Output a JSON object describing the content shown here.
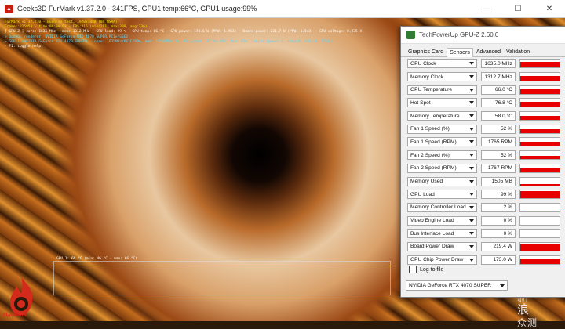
{
  "furmark": {
    "title": "Geeks3D FurMark v1.37.2.0 - 341FPS, GPU1 temp:66°C, GPU1 usage:99%",
    "overlay_lines": [
      {
        "text": "FurMark v1.37.2.0 - Burn-in test, 1920x1080 (0X MSAA)",
        "color": "y"
      },
      {
        "text": "Frames:225858 - time:00:09:03 - FPS:316 (min:281, max:399, avg:336)",
        "color": "y"
      },
      {
        "text": "[ GPU-Z ] core: 1635 MHz - mem: 1312 MHz - GPU load: 99 % - GPU temp: 66 °C - GPU power: 174.6 W (PPW: 1.961) - Board power: 221.7 W (PPW: 1.543) - GPU voltage: 0.935 V",
        "color": "w"
      },
      {
        "text": "> OpenGL renderer: NVIDIA GeForce RTX 4070 SUPER/PCIe/SSE2",
        "color": "c"
      },
      {
        "text": "> GPU 1 (NVIDIA GeForce RTX 4070 SUPER) - core: 1635MHz/66°C/99%, mem: 10500MHz/5%, GPU power: 97.4% TDP, fan: 52%, limits:[power:1, temp:0, volt:0, OV:0]",
        "color": "c"
      },
      {
        "text": "- F1: toggle help",
        "color": "w"
      }
    ],
    "graph_label": "GPU 1: 66 °C (min: 46 °C - max: 66 °C)",
    "logo_text": "FURMARK",
    "watermark_line1": "新",
    "watermark_line2": "浪",
    "watermark_line3": "众测"
  },
  "window_buttons": {
    "minimize": "—",
    "maximize": "☐",
    "close": "✕"
  },
  "gpuz": {
    "title": "TechPowerUp GPU-Z 2.60.0",
    "tabs": [
      {
        "label": "Graphics Card",
        "active": false
      },
      {
        "label": "Sensors",
        "active": true
      },
      {
        "label": "Advanced",
        "active": false
      },
      {
        "label": "Validation",
        "active": false
      }
    ],
    "sensors": [
      {
        "name": "GPU Clock",
        "value": "1635.0 MHz",
        "level": 0.7
      },
      {
        "name": "Memory Clock",
        "value": "1312.7 MHz",
        "level": 0.6
      },
      {
        "name": "GPU Temperature",
        "value": "66.0 °C",
        "level": 0.55
      },
      {
        "name": "Hot Spot",
        "value": "76.8 °C",
        "level": 0.6
      },
      {
        "name": "Memory Temperature",
        "value": "58.0 °C",
        "level": 0.5
      },
      {
        "name": "Fan 1 Speed (%)",
        "value": "52 %",
        "level": 0.45
      },
      {
        "name": "Fan 1 Speed (RPM)",
        "value": "1765 RPM",
        "level": 0.5
      },
      {
        "name": "Fan 2 Speed (%)",
        "value": "52 %",
        "level": 0.45
      },
      {
        "name": "Fan 2 Speed (RPM)",
        "value": "1767 RPM",
        "level": 0.5
      },
      {
        "name": "Memory Used",
        "value": "1505 MB",
        "level": 0.12
      },
      {
        "name": "GPU Load",
        "value": "99 %",
        "level": 0.95
      },
      {
        "name": "Memory Controller Load",
        "value": "2 %",
        "level": 0.05
      },
      {
        "name": "Video Engine Load",
        "value": "0 %",
        "level": 0
      },
      {
        "name": "Bus Interface Load",
        "value": "0 %",
        "level": 0
      },
      {
        "name": "Board Power Draw",
        "value": "219.4 W",
        "level": 0.8
      },
      {
        "name": "GPU Chip Power Draw",
        "value": "173.0 W",
        "level": 0.7
      }
    ],
    "log_label": "Log to file",
    "gpu_select": "NVIDIA GeForce RTX 4070 SUPER",
    "graph_color": "#e80000"
  }
}
